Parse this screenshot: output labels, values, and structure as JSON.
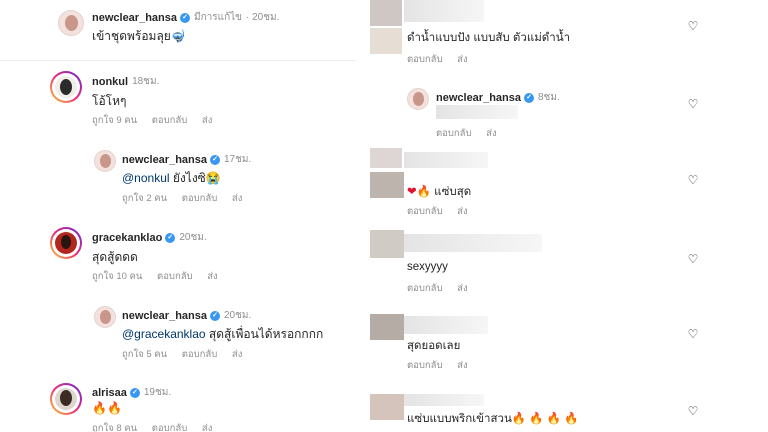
{
  "left": {
    "comments": [
      {
        "username": "newclear_hansa",
        "verified": true,
        "edited": "มีการแก้ไข",
        "time": "20ชม.",
        "text": "เข้าชุดพร้อมลุย🤿"
      },
      {
        "username": "nonkul",
        "verified": false,
        "time": "18ชม.",
        "text": "โอ้โหๆ",
        "likes": "ถูกใจ 9 คน",
        "reply": "ตอบกลับ",
        "send": "ส่ง"
      },
      {
        "username": "newclear_hansa",
        "verified": true,
        "time": "17ชม.",
        "mention": "@nonkul",
        "text": "ยังไงซิ😭",
        "likes": "ถูกใจ 2 คน",
        "reply": "ตอบกลับ",
        "send": "ส่ง"
      },
      {
        "username": "gracekanklao",
        "verified": true,
        "time": "20ชม.",
        "text": "สุดสู้ดดด",
        "likes": "ถูกใจ 10 คน",
        "reply": "ตอบกลับ",
        "send": "ส่ง"
      },
      {
        "username": "newclear_hansa",
        "verified": true,
        "time": "20ชม.",
        "mention": "@gracekanklao",
        "text": "สุดสู้เพื่อนได้หรอกกกก",
        "likes": "ถูกใจ 5 คน",
        "reply": "ตอบกลับ",
        "send": "ส่ง"
      },
      {
        "username": "alrisaa",
        "verified": true,
        "time": "19ชม.",
        "text": "🔥🔥",
        "likes": "ถูกใจ 8 คน",
        "reply": "ตอบกลับ",
        "send": "ส่ง"
      }
    ]
  },
  "right": {
    "comments": [
      {
        "text": "ดำน้ำแบบปัง แบบสับ ตัวแม่ดำน้ำ",
        "reply": "ตอบกลับ",
        "send": "ส่ง"
      },
      {
        "username": "newclear_hansa",
        "verified": true,
        "time": "8ชม.",
        "reply": "ตอบกลับ",
        "send": "ส่ง"
      },
      {
        "text": "❤️🔥 แซ่บสุด",
        "text_body": "แซ่บสุด",
        "reply": "ตอบกลับ",
        "send": "ส่ง"
      },
      {
        "text": "sexyyyy",
        "reply": "ตอบกลับ",
        "send": "ส่ง"
      },
      {
        "text": "สุดยอดเลย",
        "reply": "ตอบกลับ",
        "send": "ส่ง"
      },
      {
        "text": "แซ่บแบบพริกเข้าสวน🔥🔥🔥🔥",
        "text_body": "แซ่บแบบพริกเข้าสวน"
      }
    ]
  },
  "icons": {
    "verified": "verified-badge-icon",
    "like": "heart-outline-icon"
  },
  "colors": {
    "verified": "#3897f0",
    "meta": "#8e8e8e",
    "text": "#262626",
    "mention": "#00376b"
  }
}
